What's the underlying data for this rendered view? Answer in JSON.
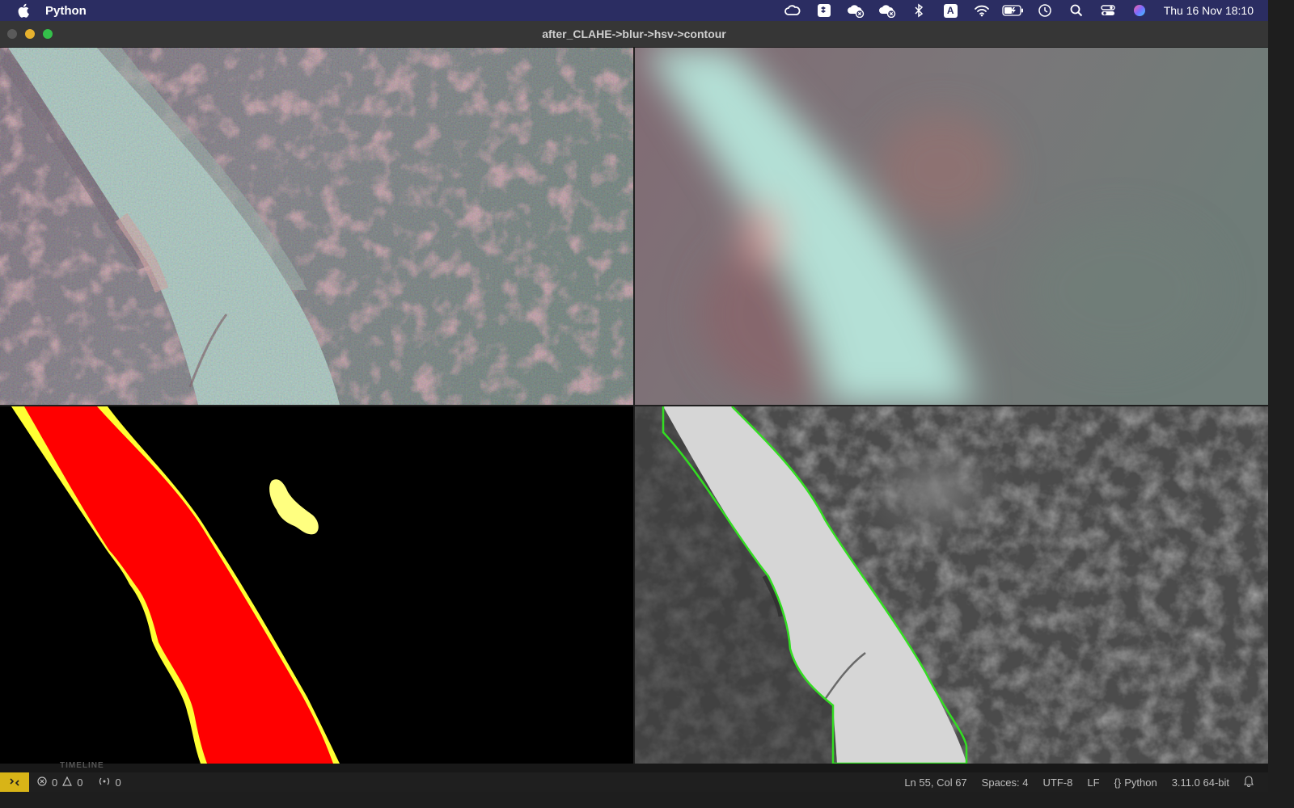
{
  "menubar": {
    "app_name": "Python",
    "datetime": "Thu 16 Nov  18:10",
    "icons": [
      "creative-cloud-icon",
      "dropbox-icon",
      "cloud-error-icon",
      "cloud-error-icon",
      "bluetooth-icon",
      "input-source-icon",
      "wifi-icon",
      "battery-icon",
      "time-machine-icon",
      "spotlight-icon",
      "control-center-icon",
      "siri-icon"
    ],
    "input_source_label": "A"
  },
  "window": {
    "title": "after_CLAHE->blur->hsv->contour",
    "traffic_lights": {
      "close": "#5a5a5a",
      "minimize": "#e6b12e",
      "zoom": "#34c04a"
    }
  },
  "panels": [
    {
      "name": "clahe-image",
      "description": "CLAHE enhanced"
    },
    {
      "name": "blurred-image",
      "description": "Blurred"
    },
    {
      "name": "hsv-mask-image",
      "description": "HSV mask"
    },
    {
      "name": "contour-image",
      "description": "Contour overlay"
    }
  ],
  "colors": {
    "mask_fill": "#ff0000",
    "mask_edge": "#ffff33",
    "mask_blob": "#ffff80",
    "contour": "#33dd22"
  },
  "peek_label": "TIMELINE",
  "statusbar": {
    "errors": "0",
    "warnings": "0",
    "ports": "0",
    "position": "Ln 55, Col 67",
    "spaces": "Spaces: 4",
    "encoding": "UTF-8",
    "eol": "LF",
    "language": "Python",
    "interpreter": "3.11.0 64-bit"
  }
}
